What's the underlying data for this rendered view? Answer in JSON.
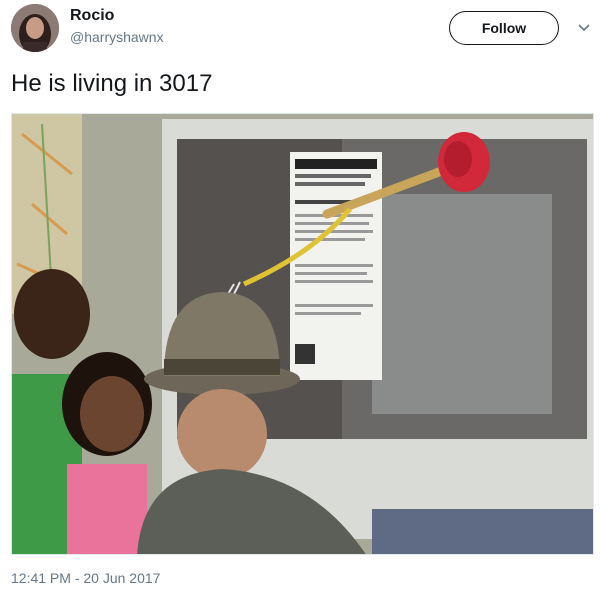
{
  "user": {
    "display_name": "Rocio",
    "handle": "@harryshawnx"
  },
  "actions": {
    "follow_label": "Follow"
  },
  "tweet": {
    "text": "He is living in 3017",
    "timestamp": "12:41 PM - 20 Jun 2017"
  },
  "icons": {
    "menu": "chevron-down-icon"
  }
}
